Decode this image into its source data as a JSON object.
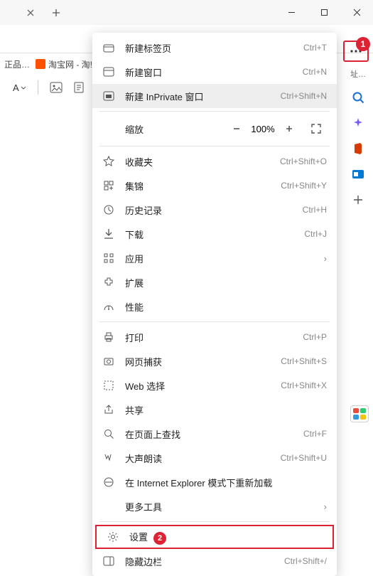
{
  "titlebar": {
    "minimize": "–",
    "maximize": "☐",
    "close": "✕"
  },
  "favorites": {
    "item1": "正品…",
    "item2": "淘宝网 - 淘! 我喜…"
  },
  "format": {
    "A": "A"
  },
  "more_badge": "1",
  "menu": {
    "new_tab": {
      "label": "新建标签页",
      "shortcut": "Ctrl+T"
    },
    "new_window": {
      "label": "新建窗口",
      "shortcut": "Ctrl+N"
    },
    "new_inprivate": {
      "label": "新建 InPrivate 窗口",
      "shortcut": "Ctrl+Shift+N"
    },
    "zoom": {
      "label": "缩放",
      "value": "100%"
    },
    "favorites": {
      "label": "收藏夹",
      "shortcut": "Ctrl+Shift+O"
    },
    "collections": {
      "label": "集锦",
      "shortcut": "Ctrl+Shift+Y"
    },
    "history": {
      "label": "历史记录",
      "shortcut": "Ctrl+H"
    },
    "downloads": {
      "label": "下载",
      "shortcut": "Ctrl+J"
    },
    "apps": {
      "label": "应用"
    },
    "extensions": {
      "label": "扩展"
    },
    "performance": {
      "label": "性能"
    },
    "print": {
      "label": "打印",
      "shortcut": "Ctrl+P"
    },
    "webcapture": {
      "label": "网页捕获",
      "shortcut": "Ctrl+Shift+S"
    },
    "webselect": {
      "label": "Web 选择",
      "shortcut": "Ctrl+Shift+X"
    },
    "share": {
      "label": "共享"
    },
    "find": {
      "label": "在页面上查找",
      "shortcut": "Ctrl+F"
    },
    "readaloud": {
      "label": "大声朗读",
      "shortcut": "Ctrl+Shift+U"
    },
    "ie_mode": {
      "label": "在 Internet Explorer 模式下重新加载"
    },
    "moretools": {
      "label": "更多工具"
    },
    "settings": {
      "label": "设置",
      "badge": "2"
    },
    "hidesidebar": {
      "label": "隐藏边栏",
      "shortcut": "Ctrl+Shift+/"
    }
  },
  "siderail_truncated": "址…"
}
